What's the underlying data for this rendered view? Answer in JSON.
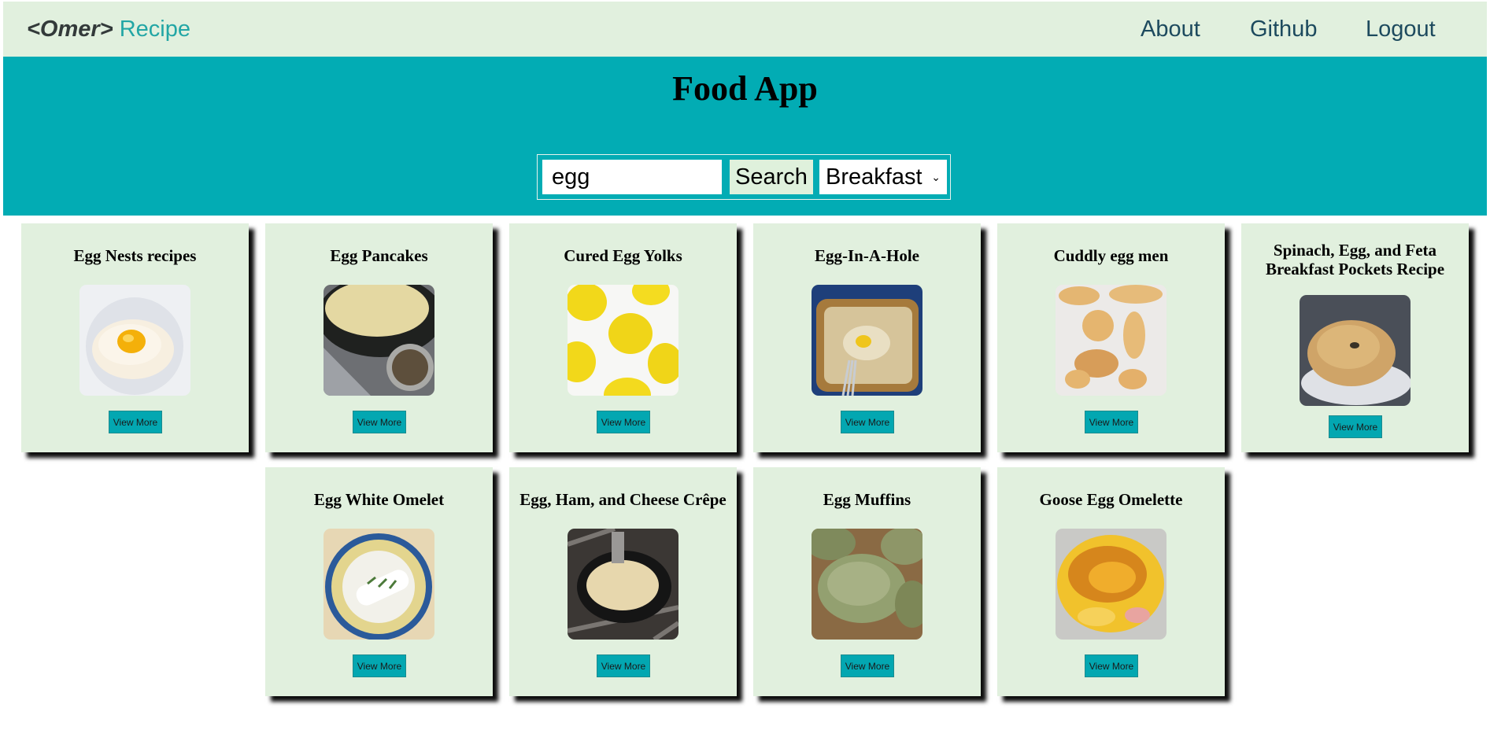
{
  "navbar": {
    "brand_tag": "<Omer>",
    "brand_name": "Recipe",
    "links": {
      "about": "About",
      "github": "Github",
      "logout": "Logout"
    }
  },
  "hero": {
    "title": "Food App",
    "search": {
      "value": "egg",
      "button_label": "Search",
      "category": "Breakfast"
    }
  },
  "recipes": [
    {
      "title": "Egg Nests recipes",
      "image_icon": "egg-nest-photo",
      "button_label": "View More"
    },
    {
      "title": "Egg Pancakes",
      "image_icon": "egg-pancakes-photo",
      "button_label": "View More"
    },
    {
      "title": "Cured Egg Yolks",
      "image_icon": "cured-egg-yolks-photo",
      "button_label": "View More"
    },
    {
      "title": "Egg-In-A-Hole",
      "image_icon": "egg-in-a-hole-photo",
      "button_label": "View More"
    },
    {
      "title": "Cuddly egg men",
      "image_icon": "cuddly-egg-men-photo",
      "button_label": "View More"
    },
    {
      "title_line1": "Spinach, Egg, and Feta",
      "title_line2": "Breakfast Pockets Recipe",
      "image_icon": "breakfast-pocket-photo",
      "button_label": "View More"
    },
    {
      "title": "Egg White Omelet",
      "image_icon": "egg-white-omelet-photo",
      "button_label": "View More"
    },
    {
      "title": "Egg, Ham, and Cheese Crêpe",
      "image_icon": "crepe-photo",
      "button_label": "View More"
    },
    {
      "title": "Egg Muffins",
      "image_icon": "egg-muffins-photo",
      "button_label": "View More"
    },
    {
      "title": "Goose Egg Omelette",
      "image_icon": "goose-egg-omelette-photo",
      "button_label": "View More"
    }
  ],
  "colors": {
    "navbar_bg": "#e1f0de",
    "hero_bg": "#02acb4",
    "brand_accent": "#22a6a5",
    "nav_link": "#1d4a5e",
    "card_bg": "#e1f0de",
    "button_bg": "#03a7b1"
  }
}
